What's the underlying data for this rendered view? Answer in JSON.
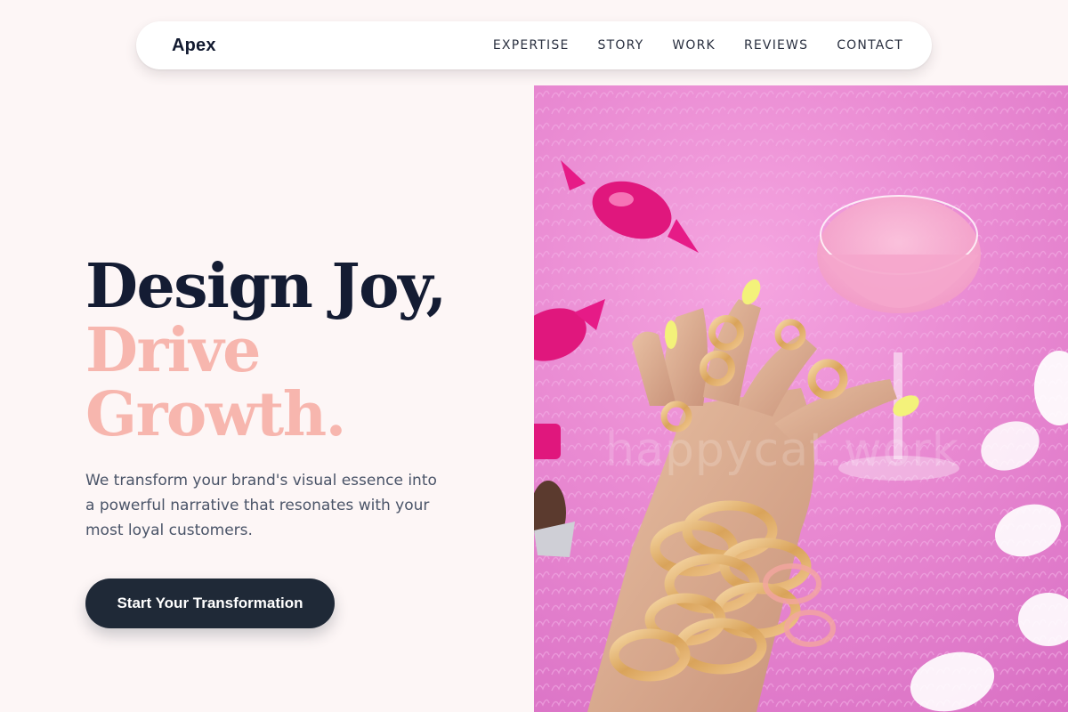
{
  "nav": {
    "brand": "Apex",
    "links": [
      "EXPERTISE",
      "STORY",
      "WORK",
      "REVIEWS",
      "CONTACT"
    ]
  },
  "hero": {
    "headline_line1": "Design Joy,",
    "headline_line2": "Drive",
    "headline_line3": "Growth.",
    "subtext": "We transform your brand's visual essence into a powerful narrative that resonates with your most loyal customers.",
    "cta_label": "Start Your Transformation",
    "image_watermark": "happycat.work"
  },
  "colors": {
    "background": "#fdf6f6",
    "headline_dark": "#141c33",
    "headline_accent": "#f7b6ae",
    "cta_background": "#1f2937",
    "image_pink": "#e98ad2"
  }
}
